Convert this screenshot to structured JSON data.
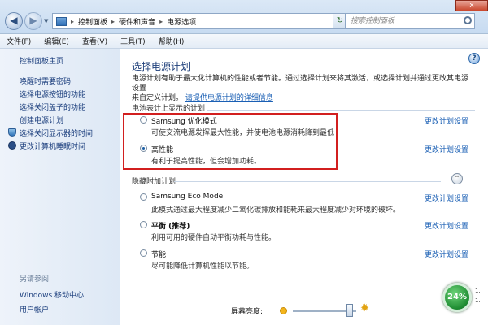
{
  "window": {
    "breadcrumbs": [
      "控制面板",
      "硬件和声音",
      "电源选项"
    ],
    "search_placeholder": "搜索控制面板",
    "close_label": "x"
  },
  "menu": [
    "文件(F)",
    "编辑(E)",
    "查看(V)",
    "工具(T)",
    "帮助(H)"
  ],
  "sidebar": {
    "home": "控制面板主页",
    "items": [
      {
        "label": "唤醒时需要密码",
        "icon": ""
      },
      {
        "label": "选择电源按钮的功能",
        "icon": ""
      },
      {
        "label": "选择关闭盖子的功能",
        "icon": ""
      },
      {
        "label": "创建电源计划",
        "icon": ""
      },
      {
        "label": "选择关闭显示器的时间",
        "icon": "shield-icon"
      },
      {
        "label": "更改计算机睡眠时间",
        "icon": "moon-icon"
      }
    ],
    "see_also_title": "另请参阅",
    "see_also": [
      "Windows 移动中心",
      "用户帐户"
    ]
  },
  "main": {
    "title": "选择电源计划",
    "intro_line1": "电源计划有助于最大化计算机的性能或者节能。通过选择计划来将其激活，或选择计划并通过更改其电源设置",
    "intro_line2": "来自定义计划。",
    "intro_link": "请提供电源计划的详细信息",
    "section_battery": "电池表计上显示的计划",
    "section_hidden": "隐藏附加计划",
    "change_label": "更改计划设置",
    "plans_shown": [
      {
        "name": "Samsung 优化模式",
        "desc": "可使交流电源发挥最大性能，并使电池电源消耗降到最低",
        "selected": false,
        "bold": false
      },
      {
        "name": "高性能",
        "desc": "有利于提高性能，但会增加功耗。",
        "selected": true,
        "bold": false
      }
    ],
    "plans_hidden": [
      {
        "name": "Samsung Eco Mode",
        "desc": "此模式通过最大程度减少二氧化碳排放和能耗来最大程度减少对环境的破坏。",
        "selected": false,
        "bold": false
      },
      {
        "name": "平衡 (推荐)",
        "desc": "利用可用的硬件自动平衡功耗与性能。",
        "selected": false,
        "bold": true
      },
      {
        "name": "节能",
        "desc": "尽可能降低计算机性能以节能。",
        "selected": false,
        "bold": false
      }
    ],
    "brightness_label": "屏幕亮度:"
  },
  "widget": {
    "percent": "24%",
    "stat1": "1.",
    "stat2": "1."
  },
  "colors": {
    "accent_link": "#1a5fb4",
    "highlight_box": "#d21f1f",
    "title_blue": "#1e3f7a"
  }
}
